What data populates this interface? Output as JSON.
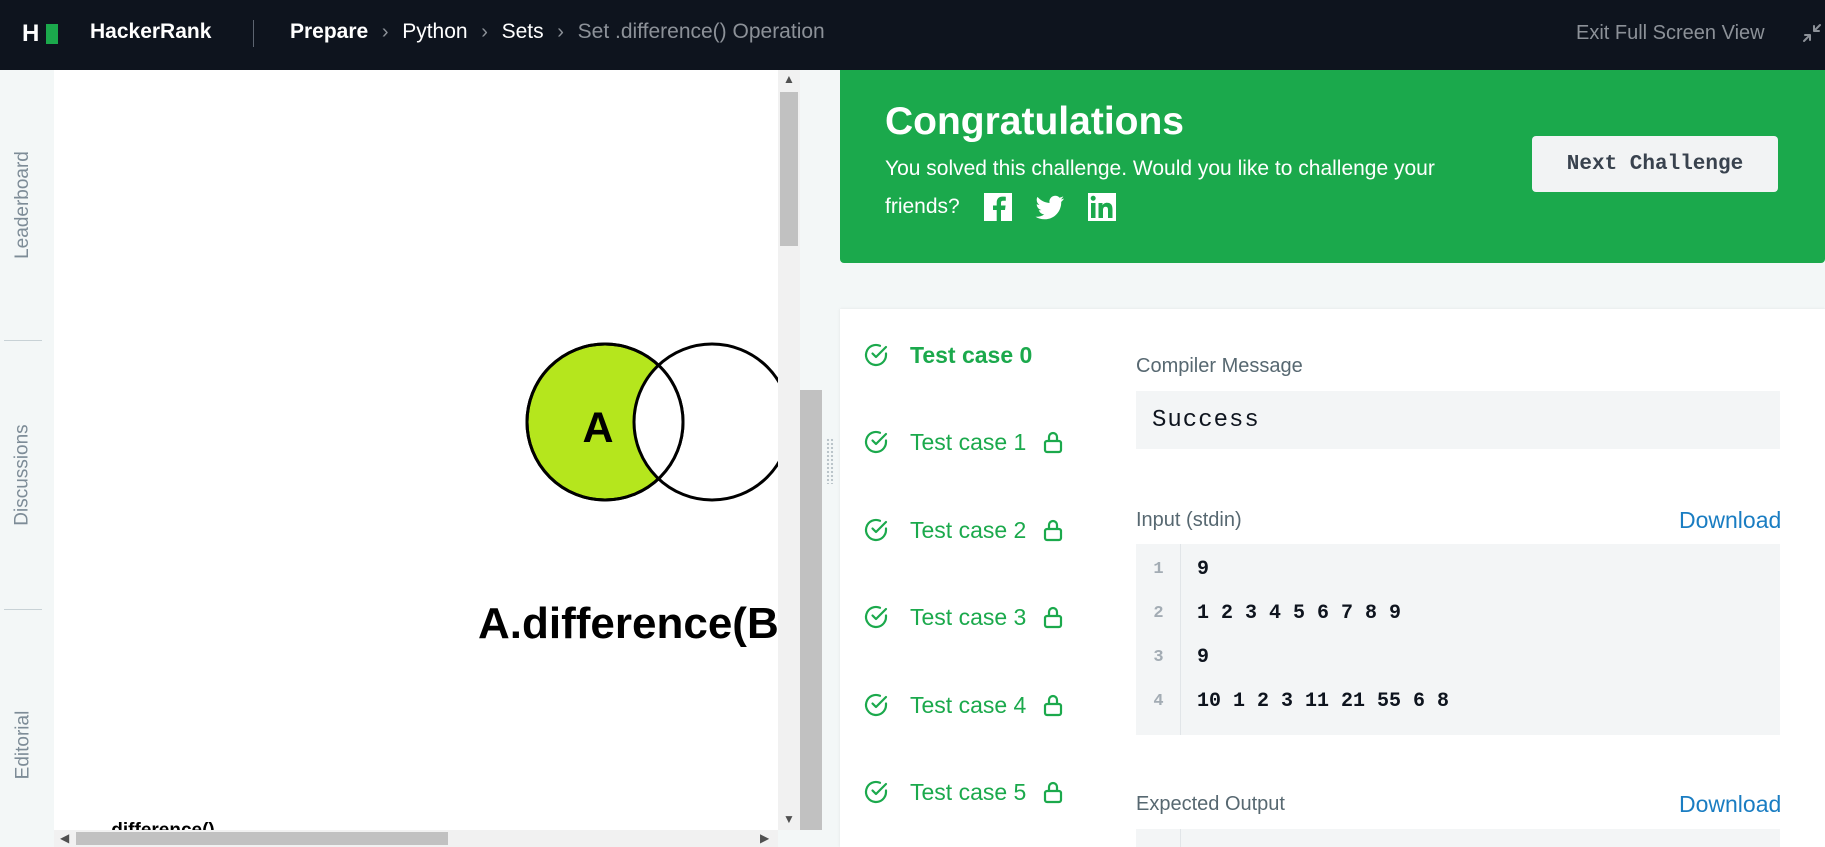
{
  "header": {
    "brand": "HackerRank",
    "breadcrumbs": [
      "Prepare",
      "Python",
      "Sets",
      "Set .difference() Operation"
    ],
    "exit_fullscreen": "Exit Full Screen View"
  },
  "rail": [
    "Leaderboard",
    "Discussions",
    "Editorial"
  ],
  "problem": {
    "venn_set_label": "A",
    "venn_caption": "A.difference(B",
    "cut_text": ".difference()",
    "venn_fill_color": "#b5e61d"
  },
  "congrats": {
    "title": "Congratulations",
    "subtitle": "You solved this challenge. Would you like to challenge your friends?",
    "next_button": "Next Challenge",
    "accent_color": "#1ba94c"
  },
  "results": {
    "test_cases": [
      {
        "label": "Test case 0",
        "locked": false,
        "passed": true,
        "active": true
      },
      {
        "label": "Test case 1",
        "locked": true,
        "passed": true,
        "active": false
      },
      {
        "label": "Test case 2",
        "locked": true,
        "passed": true,
        "active": false
      },
      {
        "label": "Test case 3",
        "locked": true,
        "passed": true,
        "active": false
      },
      {
        "label": "Test case 4",
        "locked": true,
        "passed": true,
        "active": false
      },
      {
        "label": "Test case 5",
        "locked": true,
        "passed": true,
        "active": false
      }
    ],
    "compiler_label": "Compiler Message",
    "compiler_message": "Success",
    "input_label": "Input (stdin)",
    "download_label": "Download",
    "input_lines": [
      "9",
      "1 2 3 4 5 6 7 8 9",
      "9",
      "10 1 2 3 11 21 55 6 8"
    ],
    "input_line_numbers": [
      "1",
      "2",
      "3",
      "4"
    ],
    "expected_label": "Expected Output"
  }
}
